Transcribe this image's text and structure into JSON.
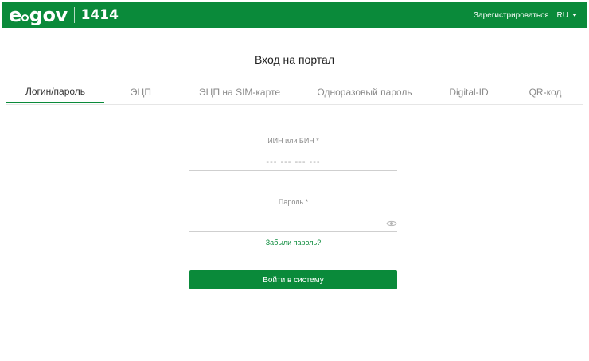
{
  "header": {
    "logo_text_e": "e",
    "logo_text_gov": "gov",
    "phone": "1414",
    "register_label": "Зарегистрироваться",
    "lang_label": "RU",
    "brand_color": "#0a8a3a"
  },
  "page": {
    "title": "Вход на портал"
  },
  "tabs": [
    {
      "label": "Логин/пароль",
      "active": true
    },
    {
      "label": "ЭЦП",
      "active": false
    },
    {
      "label": "ЭЦП на SIM-карте",
      "active": false
    },
    {
      "label": "Одноразовый пароль",
      "active": false
    },
    {
      "label": "Digital-ID",
      "active": false
    },
    {
      "label": "QR-код",
      "active": false
    }
  ],
  "form": {
    "iin_label": "ИИН или БИН *",
    "iin_value": "",
    "iin_placeholder": "--- --- --- ---",
    "password_label": "Пароль *",
    "password_value": "",
    "password_icon": "eye-icon",
    "forgot_label": "Забыли пароль?",
    "submit_label": "Войти в систему"
  }
}
